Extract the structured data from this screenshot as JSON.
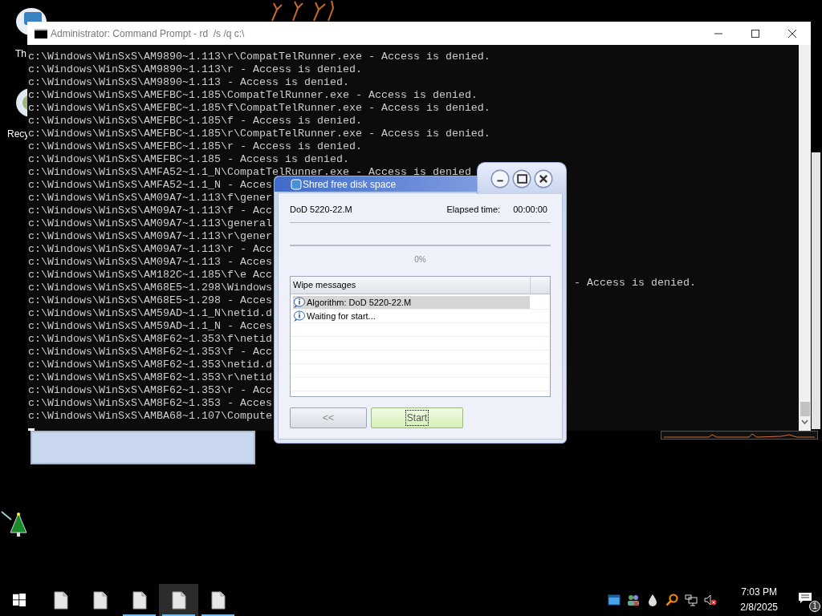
{
  "desktop": {
    "icons": [
      {
        "label": "Th"
      },
      {
        "label": "Recy"
      }
    ]
  },
  "console": {
    "title": "Administrator: Command Prompt - rd  /s /q c:\\",
    "lines": [
      {
        "text": "c:\\Windows\\WinSxS\\AM9890~1.113\\r\\CompatTelRunner.exe - Access is denied."
      },
      {
        "text": "c:\\Windows\\WinSxS\\AM9890~1.113\\r - Access is denied."
      },
      {
        "text": "c:\\Windows\\WinSxS\\AM9890~1.113 - Access is denied."
      },
      {
        "text": "c:\\Windows\\WinSxS\\AMEFBC~1.185\\CompatTelRunner.exe - Access is denied."
      },
      {
        "text": "c:\\Windows\\WinSxS\\AMEFBC~1.185\\f\\CompatTelRunner.exe - Access is denied."
      },
      {
        "text": "c:\\Windows\\WinSxS\\AMEFBC~1.185\\f - Access is denied."
      },
      {
        "text": "c:\\Windows\\WinSxS\\AMEFBC~1.185\\r\\CompatTelRunner.exe - Access is denied."
      },
      {
        "text": "c:\\Windows\\WinSxS\\AMEFBC~1.185\\r - Access is denied."
      },
      {
        "text": "c:\\Windows\\WinSxS\\AMEFBC~1.185 - Access is denied."
      },
      {
        "text": "c:\\Windows\\WinSxS\\AMFA52~1.1_N\\CompatTelRunner.exe - Access is denied"
      },
      {
        "text": "c:\\Windows\\WinSxS\\AMFA52~1.1_N - Acces"
      },
      {
        "text": "c:\\Windows\\WinSxS\\AM09A7~1.113\\f\\gener"
      },
      {
        "text": "c:\\Windows\\WinSxS\\AM09A7~1.113\\f - Acc"
      },
      {
        "text": "c:\\Windows\\WinSxS\\AM09A7~1.113\\general"
      },
      {
        "text": "c:\\Windows\\WinSxS\\AM09A7~1.113\\r\\gener"
      },
      {
        "text": "c:\\Windows\\WinSxS\\AM09A7~1.113\\r - Acc"
      },
      {
        "text": "c:\\Windows\\WinSxS\\AM09A7~1.113 - Acces"
      },
      {
        "text": "c:\\Windows\\WinSxS\\AM182C~1.185\\f\\e Acc"
      },
      {
        "text": "c:\\Windows\\WinSxS\\AM68E5~1.298\\Windows",
        "tail": "- Access is denied."
      },
      {
        "text": "c:\\Windows\\WinSxS\\AM68E5~1.298 - Acces"
      },
      {
        "text": "c:\\Windows\\WinSxS\\AM59AD~1.1_N\\netid.d"
      },
      {
        "text": "c:\\Windows\\WinSxS\\AM59AD~1.1_N - Acces"
      },
      {
        "text": "c:\\Windows\\WinSxS\\AM8F62~1.353\\f\\netid"
      },
      {
        "text": "c:\\Windows\\WinSxS\\AM8F62~1.353\\f - Acc"
      },
      {
        "text": "c:\\Windows\\WinSxS\\AM8F62~1.353\\netid.d"
      },
      {
        "text": "c:\\Windows\\WinSxS\\AM8F62~1.353\\r\\netid"
      },
      {
        "text": "c:\\Windows\\WinSxS\\AM8F62~1.353\\r - Acc"
      },
      {
        "text": "c:\\Windows\\WinSxS\\AM8F62~1.353 - Acces"
      },
      {
        "text": "c:\\Windows\\WinSxS\\AMBA68~1.107\\Compute"
      }
    ]
  },
  "dialog": {
    "title": "Shred free disk space",
    "algorithm": "DoD 5220-22.M",
    "elapsed_label": "Elapsed time:",
    "elapsed": "00:00:00",
    "progress": {
      "level": 0,
      "reading": "0%"
    },
    "messages": {
      "column": "Wipe messages",
      "rows": [
        {
          "text": "Algorithm: DoD 5220-22.M",
          "selected": true
        },
        {
          "text": "Waiting for start...",
          "selected": false
        }
      ]
    },
    "buttons": [
      {
        "label": "<<",
        "focused": false
      },
      {
        "label": "Start",
        "focused": true
      }
    ]
  },
  "taskbar": {
    "apps": [
      {
        "running": false,
        "selected": false
      },
      {
        "running": false,
        "selected": false
      },
      {
        "running": true,
        "selected": false
      },
      {
        "running": true,
        "selected": true
      },
      {
        "running": true,
        "selected": false
      }
    ],
    "clock": {
      "time": "7:03 PM",
      "date": "2/8/2025"
    },
    "notifications": "1"
  }
}
